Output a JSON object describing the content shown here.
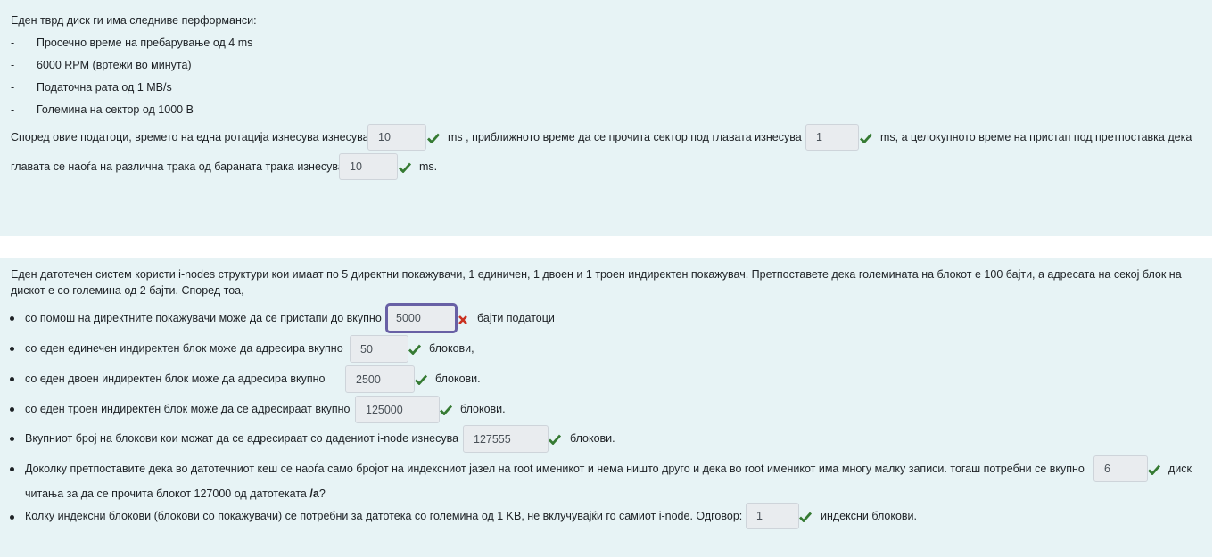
{
  "q1": {
    "intro": "Еден тврд диск ги има следниве перформанси:",
    "bullet_char": "-",
    "items": [
      "Просечно време на пребарување од 4 ms",
      "6000 RPM (вртежи во минута)",
      "Податочна рата од 1 MB/s",
      "Големина на сектор од 1000 B"
    ],
    "text_a": "Според овие податоци, времето на една ротација изнесува изнесува",
    "answer_1": "10",
    "text_b": "ms , приближното време  да се прочита сектор под главата изнесува",
    "answer_2": "1",
    "text_c": "ms, а целокупното време на пристап под претпоставка дека",
    "text_d": "главата се наоѓа на различна трака од бараната трака изнесува",
    "answer_3": "10",
    "text_e": "ms."
  },
  "q2": {
    "intro_line1": "Еден датотечен систем користи i-nodes структури кои имаат по 5 директни покажувачи, 1 единичен, 1 двоен и 1 троен индиректен покажувач. Претпоставете дека големината на блокот е 100 бајти, а адресата на секој блок на",
    "intro_line2": "дискот е со големина од 2 бајти. Според тоа,",
    "b1_text": "со помош на директните покажувачи може да се пристапи до вкупно",
    "b1_answer": "5000",
    "b1_after": "бајти податоци",
    "b2_text": "со еден единечен индиректен блок може да адресира вкупно",
    "b2_answer": "50",
    "b2_after": "блокови,",
    "b3_text": "со еден двоен индиректен блок може да адресира  вкупно",
    "b3_answer": "2500",
    "b3_after": "блокови.",
    "b4_text": " со еден троен индиректен блок може да се адресираат вкупно",
    "b4_answer": "125000",
    "b4_after": "блокови.",
    "b5_text": "Вкупниот број на блокови кои можат да се адресираат со дадениот i-node изнесува",
    "b5_answer": "127555",
    "b5_after": "блокови.",
    "b6_text": "Доколку претпоставите дека во датотечниот кеш се наоѓа само бројот на индексниот јазел на root именикот и нема ништо друго и дека во root именикот има многу малку записи. тогаш потребни се вкупно",
    "b6_answer": "6",
    "b6_after": "диск",
    "b6_line2_pre": "читања за да се прочита блокот 127000 од датотеката ",
    "b6_line2_bold": "/a",
    "b6_line2_post": "?",
    "b7_text": "Колку индексни блокови (блокови со покажувачи) се потребни за датотека со големина од 1 KB, не вклучувајќи го самиот i-node. Одговор:",
    "b7_answer": "1",
    "b7_after": "индексни блокови."
  },
  "colors": {
    "panel_bg": "#e7f3f5",
    "correct": "#357a32",
    "incorrect": "#ca3120",
    "focus_border": "#6860a5",
    "input_bg": "#e9ecef"
  },
  "icons": {
    "correct": "check-icon",
    "incorrect": "cross-icon"
  }
}
